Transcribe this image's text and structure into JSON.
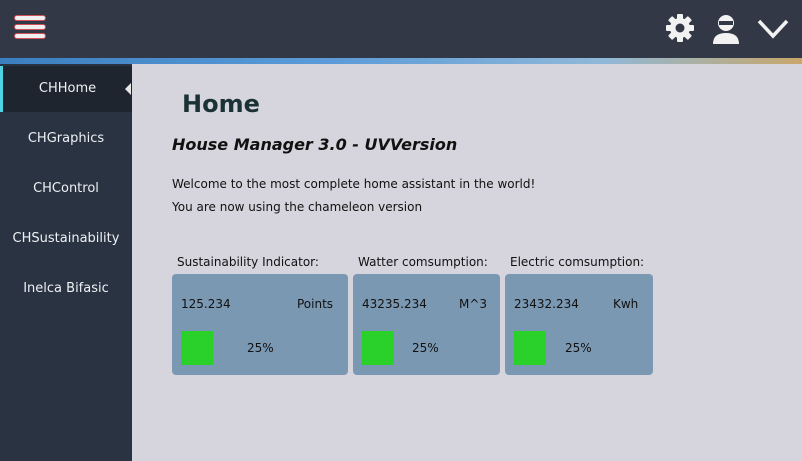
{
  "sidebar": {
    "items": [
      {
        "label": "CHHome"
      },
      {
        "label": "CHGraphics"
      },
      {
        "label": "CHControl"
      },
      {
        "label": "CHSustainability"
      },
      {
        "label": "Inelca Bifasic"
      }
    ]
  },
  "main": {
    "title": "Home",
    "subtitle": "House Manager 3.0 - UVVersion",
    "welcome_line1": "Welcome to the most complete home assistant in the world!",
    "welcome_line2": "You are now using the chameleon version"
  },
  "cards": [
    {
      "label": "Sustainability Indicator:",
      "value": "125.234",
      "unit": "Points",
      "percent": "25%",
      "level": 0.25
    },
    {
      "label": "Watter comsumption:",
      "value": "43235.234",
      "unit": "M^3",
      "percent": "25%",
      "level": 0.25
    },
    {
      "label": "Electric comsumption:",
      "value": "23432.234",
      "unit": "Kwh",
      "percent": "25%",
      "level": 0.25
    }
  ],
  "colors": {
    "topbar": "#323846",
    "sidebar": "#293341",
    "main_bg": "#d6d4dc",
    "card_bg": "#7b98b3",
    "indicator_green": "#2ad12a",
    "active_accent": "#4fd1e6"
  },
  "icons": {
    "menu": "hamburger-menu-icon",
    "settings": "gear-icon",
    "user": "user-icon",
    "dropdown": "chevron-down-icon"
  }
}
